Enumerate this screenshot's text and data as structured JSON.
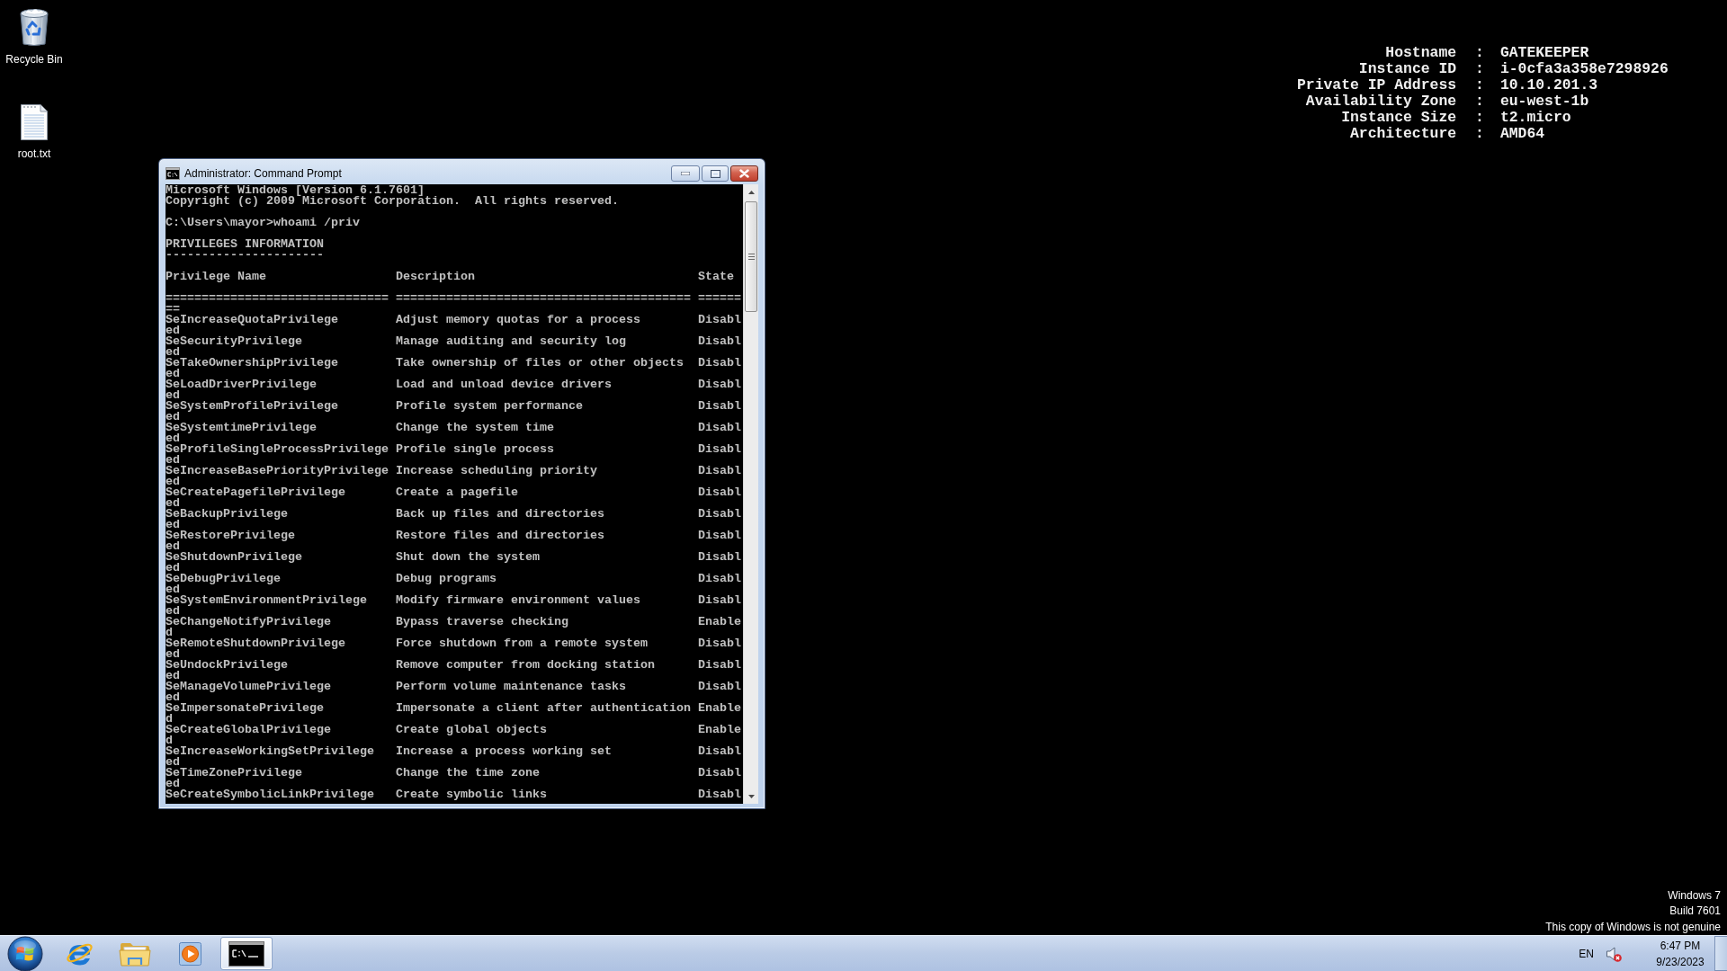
{
  "desktop": {
    "icons": [
      {
        "kind": "recycle-bin",
        "label": "Recycle Bin"
      },
      {
        "kind": "text-file",
        "label": "root.txt"
      }
    ],
    "system_info": [
      {
        "label": "Hostname",
        "separator": ":",
        "value": "GATEKEEPER"
      },
      {
        "label": "Instance ID",
        "separator": ":",
        "value": "i-0cfa3a358e7298926"
      },
      {
        "label": "Private IP Address",
        "separator": ":",
        "value": "10.10.201.3"
      },
      {
        "label": "Availability Zone",
        "separator": ":",
        "value": "eu-west-1b"
      },
      {
        "label": "Instance Size",
        "separator": ":",
        "value": "t2.micro"
      },
      {
        "label": "Architecture",
        "separator": ":",
        "value": "AMD64"
      }
    ],
    "notice": [
      "Windows 7",
      "Build 7601",
      "This copy of Windows is not genuine"
    ]
  },
  "window": {
    "title": "Administrator: Command Prompt",
    "console": {
      "intro": [
        [
          "Microsoft Windows [Version 6.1.7601]",
          "Copyright (c) 2009 Microsoft Corporation.  All rights reserved."
        ],
        [
          "C:\\Users\\mayor>whoami /priv"
        ],
        [
          "PRIVILEGES INFORMATION",
          "----------------------"
        ]
      ],
      "table": {
        "columns": [
          "Privilege Name",
          "Description",
          "State"
        ],
        "rule": [
          "===============================",
          "=========================================",
          "======"
        ],
        "rule_wrap": "==",
        "rows": [
          {
            "name": "SeIncreaseQuotaPrivilege",
            "description": "Adjust memory quotas for a process",
            "state": "Disabl",
            "wrap": "ed"
          },
          {
            "name": "SeSecurityPrivilege",
            "description": "Manage auditing and security log",
            "state": "Disabl",
            "wrap": "ed"
          },
          {
            "name": "SeTakeOwnershipPrivilege",
            "description": "Take ownership of files or other objects",
            "state": "Disabl",
            "wrap": "ed"
          },
          {
            "name": "SeLoadDriverPrivilege",
            "description": "Load and unload device drivers",
            "state": "Disabl",
            "wrap": "ed"
          },
          {
            "name": "SeSystemProfilePrivilege",
            "description": "Profile system performance",
            "state": "Disabl",
            "wrap": "ed"
          },
          {
            "name": "SeSystemtimePrivilege",
            "description": "Change the system time",
            "state": "Disabl",
            "wrap": "ed"
          },
          {
            "name": "SeProfileSingleProcessPrivilege",
            "description": "Profile single process",
            "state": "Disabl",
            "wrap": "ed"
          },
          {
            "name": "SeIncreaseBasePriorityPrivilege",
            "description": "Increase scheduling priority",
            "state": "Disabl",
            "wrap": "ed"
          },
          {
            "name": "SeCreatePagefilePrivilege",
            "description": "Create a pagefile",
            "state": "Disabl",
            "wrap": "ed"
          },
          {
            "name": "SeBackupPrivilege",
            "description": "Back up files and directories",
            "state": "Disabl",
            "wrap": "ed"
          },
          {
            "name": "SeRestorePrivilege",
            "description": "Restore files and directories",
            "state": "Disabl",
            "wrap": "ed"
          },
          {
            "name": "SeShutdownPrivilege",
            "description": "Shut down the system",
            "state": "Disabl",
            "wrap": "ed"
          },
          {
            "name": "SeDebugPrivilege",
            "description": "Debug programs",
            "state": "Disabl",
            "wrap": "ed"
          },
          {
            "name": "SeSystemEnvironmentPrivilege",
            "description": "Modify firmware environment values",
            "state": "Disabl",
            "wrap": "ed"
          },
          {
            "name": "SeChangeNotifyPrivilege",
            "description": "Bypass traverse checking",
            "state": "Enable",
            "wrap": "d"
          },
          {
            "name": "SeRemoteShutdownPrivilege",
            "description": "Force shutdown from a remote system",
            "state": "Disabl",
            "wrap": "ed"
          },
          {
            "name": "SeUndockPrivilege",
            "description": "Remove computer from docking station",
            "state": "Disabl",
            "wrap": "ed"
          },
          {
            "name": "SeManageVolumePrivilege",
            "description": "Perform volume maintenance tasks",
            "state": "Disabl",
            "wrap": "ed"
          },
          {
            "name": "SeImpersonatePrivilege",
            "description": "Impersonate a client after authentication",
            "state": "Enable",
            "wrap": "d"
          },
          {
            "name": "SeCreateGlobalPrivilege",
            "description": "Create global objects",
            "state": "Enable",
            "wrap": "d"
          },
          {
            "name": "SeIncreaseWorkingSetPrivilege",
            "description": "Increase a process working set",
            "state": "Disabl",
            "wrap": "ed"
          },
          {
            "name": "SeTimeZonePrivilege",
            "description": "Change the time zone",
            "state": "Disabl",
            "wrap": "ed"
          },
          {
            "name": "SeCreateSymbolicLinkPrivilege",
            "description": "Create symbolic links",
            "state": "Disabl"
          }
        ]
      }
    }
  },
  "taskbar": {
    "apps": [
      {
        "kind": "browser",
        "selected": false
      },
      {
        "kind": "file-explorer",
        "selected": false
      },
      {
        "kind": "media-player",
        "selected": false
      },
      {
        "kind": "console",
        "selected": true
      }
    ],
    "tray": {
      "language": "EN",
      "volume_muted": true,
      "time": "6:47 PM",
      "date": "9/23/2023"
    }
  }
}
